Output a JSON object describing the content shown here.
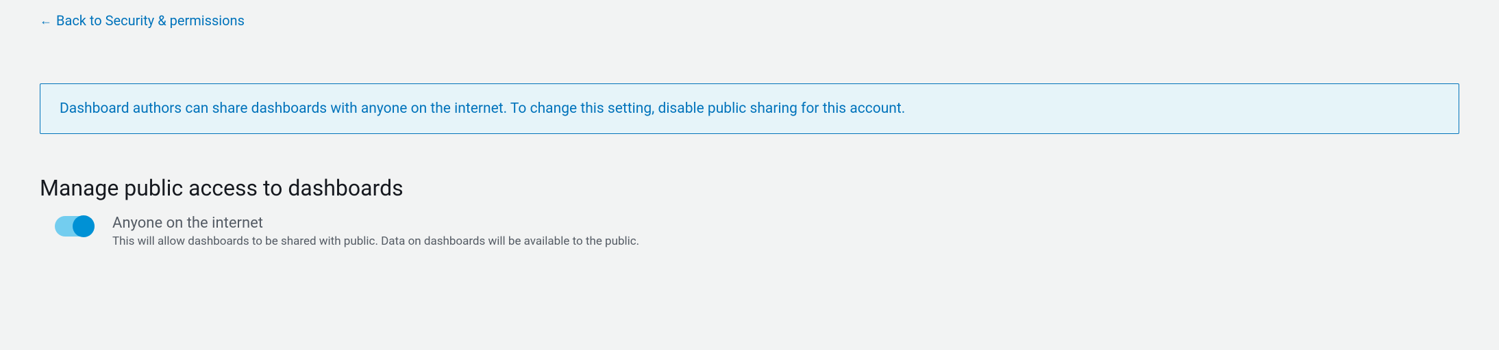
{
  "back_link": {
    "label": "Back to Security & permissions"
  },
  "info_banner": {
    "message": "Dashboard authors can share dashboards with anyone on the internet. To change this setting, disable public sharing for this account."
  },
  "section": {
    "title": "Manage public access to dashboards"
  },
  "toggle": {
    "title": "Anyone on the internet",
    "description": "This will allow dashboards to be shared with public. Data on dashboards will be available to the public.",
    "enabled": true
  }
}
